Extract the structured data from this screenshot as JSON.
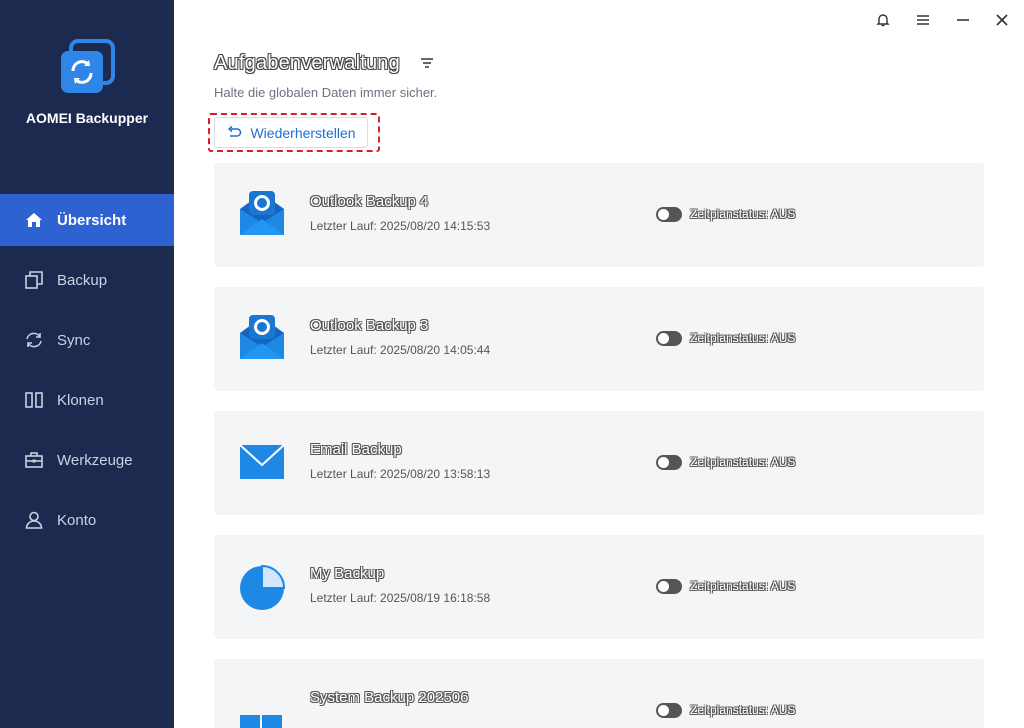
{
  "app": {
    "name": "AOMEI Backupper"
  },
  "window": {
    "controls": [
      "bell-icon",
      "menu-icon",
      "minimize-icon",
      "close-icon"
    ]
  },
  "sidebar": {
    "items": [
      {
        "label": "Übersicht",
        "icon": "home-icon",
        "active": true
      },
      {
        "label": "Backup",
        "icon": "copy-icon",
        "active": false
      },
      {
        "label": "Sync",
        "icon": "sync-icon",
        "active": false
      },
      {
        "label": "Klonen",
        "icon": "clone-icon",
        "active": false
      },
      {
        "label": "Werkzeuge",
        "icon": "toolbox-icon",
        "active": false
      },
      {
        "label": "Konto",
        "icon": "user-icon",
        "active": false
      }
    ]
  },
  "main": {
    "title": "Aufgabenverwaltung",
    "subtitle": "Halte die globalen Daten immer sicher.",
    "restore_label": "Wiederherstellen",
    "tasks": [
      {
        "name": "Outlook Backup 4",
        "last_run": "Letzter Lauf: 2025/08/20 14:15:53",
        "schedule": "Zeitplanstatus: AUS",
        "icon": "outlook-icon"
      },
      {
        "name": "Outlook Backup 3",
        "last_run": "Letzter Lauf: 2025/08/20 14:05:44",
        "schedule": "Zeitplanstatus: AUS",
        "icon": "outlook-icon"
      },
      {
        "name": "Email Backup",
        "last_run": "Letzter Lauf: 2025/08/20 13:58:13",
        "schedule": "Zeitplanstatus: AUS",
        "icon": "mail-icon"
      },
      {
        "name": "My Backup",
        "last_run": "Letzter Lauf: 2025/08/19 16:18:58",
        "schedule": "Zeitplanstatus: AUS",
        "icon": "pie-chart-icon"
      },
      {
        "name": "System Backup 202506",
        "last_run": "",
        "schedule": "Zeitplanstatus: AUS",
        "icon": "windows-icon"
      }
    ]
  },
  "colors": {
    "sidebar_bg": "#1b2a4e",
    "active_nav": "#2f62d1",
    "accent": "#1f6fd1",
    "highlight": "#d61f26"
  }
}
